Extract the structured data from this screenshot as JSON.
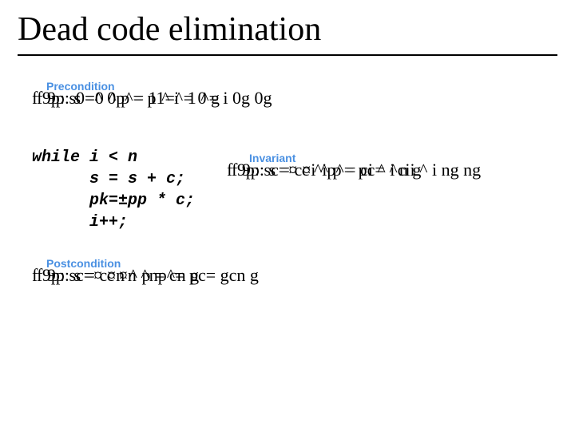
{
  "title": "Dead code elimination",
  "labels": {
    "precondition": "Precondition",
    "invariant": "Invariant",
    "postcondition": "Postcondition"
  },
  "precondition_formula": {
    "layer1": "f 9p: s0=^ 0p^= p1=^ 1 ^= i 0g 0g",
    "layer2": "f 9p: s =0 ^ p = 1 ^  i = 0 g"
  },
  "code_lines": [
    "while i < n",
    "      s = s + c;",
    "      pk=±pp * c;",
    "      i++;"
  ],
  "invariant_formula": {
    "layer1": "f 9p: sc=¤ c ^ip^= pc= ^cii ^  i ng ng",
    "layer2": "f 9p: s = c¤i ^ p = ci ^ i   n g"
  },
  "postcondition_formula": {
    "layer1": "f 9p: sc=¤ c ¤n ^np^= pc= gcn g",
    "layer2": "f 9p: s = c¤n ^ p = cn g"
  }
}
